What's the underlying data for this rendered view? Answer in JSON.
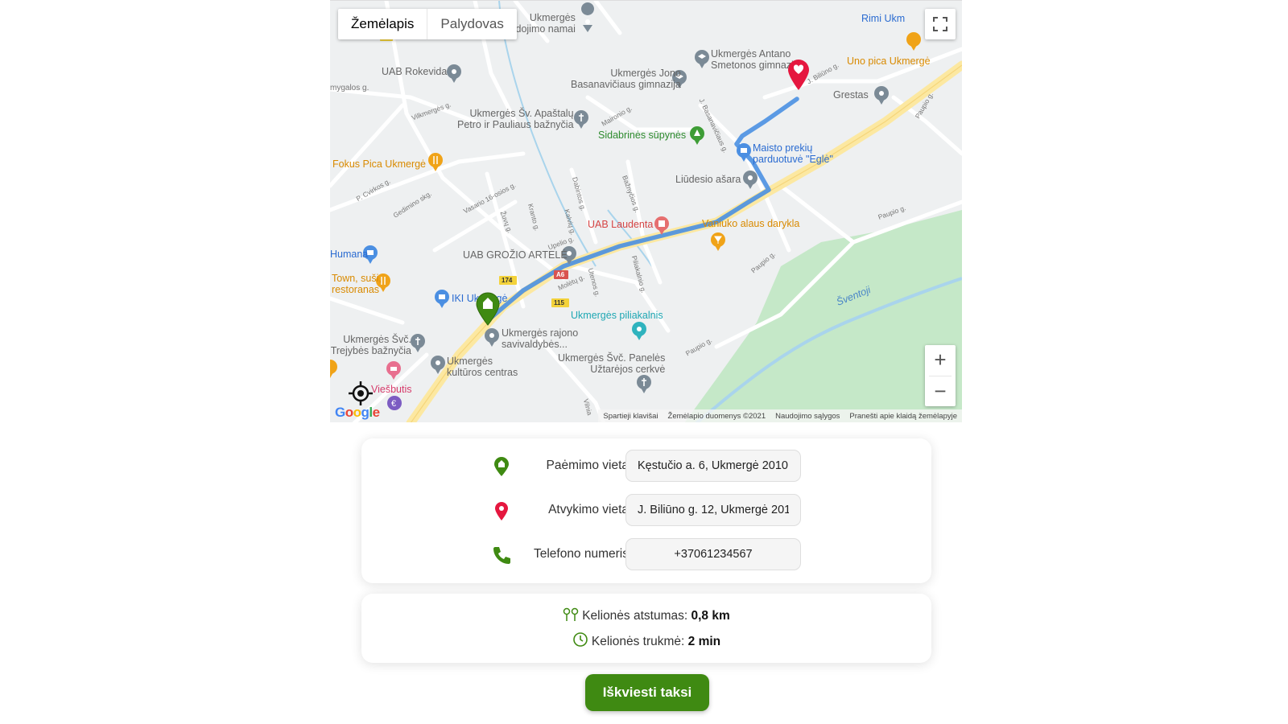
{
  "map": {
    "tabs": [
      {
        "label": "Žemėlapis",
        "active": true
      },
      {
        "label": "Palydovas",
        "active": false
      }
    ],
    "pois": {
      "laidojimo": "Ukmergės\nlaidojimo namai",
      "rimi": "Rimi Ukm",
      "smetonos": "Ukmergės Antano\nSmetonos gimnazija",
      "basanaviciaus": "Ukmergės Jono\nBasanavičiaus gimnazija",
      "unopica": "Uno pica Ukmergė",
      "rokevida": "UAB Rokevida",
      "baznycia": "Ukmergės Šv. Apaštalų\nPetro ir Pauliaus bažnyčia",
      "grestas": "Grestas",
      "supynes": "Sidabrinės sūpynės",
      "egle": "Maisto prekių\nparduotuvė \"Eglė\"",
      "fokus": "Fokus Pica Ukmergė",
      "liudesio": "Liūdesio ašara",
      "laudenta": "UAB Laudenta",
      "vaniuko": "Vaniuko alaus darykla",
      "humana": "Humana",
      "grozio": "UAB GROŽIO ARTELĖ",
      "town": "Town, suši,\nrestoranas",
      "iki": "IKI Ukmergė",
      "piliakalnis": "Ukmergės piliakalnis",
      "savivaldybe": "Ukmergės rajono\nsavivaldybės...",
      "trejybes": "Ukmergės Švč.\nTrejybės bažnyčia",
      "paneles": "Ukmergės Švč. Panelės\nUžtarėjos cerkvė",
      "kulturos": "Ukmergės\nkultūros centras",
      "viesbutis": "Viešbutis",
      "sventoji": "Šventoji"
    },
    "streets": {
      "mygalos": "mygalos g.",
      "vilkmerges": "Vilkmergės g.",
      "cvirkos": "P. Cvirkos g.",
      "gedimino": "Gedimino skg.",
      "vasario": "Vasario 16-osios g.",
      "zuvu": "Žuvų g.",
      "kranto": "Kranto g.",
      "dabintos": "Dabintos g.",
      "kalvių": "Kalvių g.",
      "baznycios": "Bažnyčios g.",
      "maironio": "Maironio g.",
      "jbasanaviciaus": "J. Basanavičiaus g.",
      "biliuno": "J. Biliūno g.",
      "paupio": "Paupio g.",
      "upelio": "Upelio g.",
      "moletu": "Molėtų g.",
      "utenos": "Utenos g.",
      "pilialkalnio": "Piliakalnio g.",
      "vilnius": "Vilnia"
    },
    "road_shields": [
      "A6",
      "174",
      "115"
    ],
    "controls": {
      "zoom_in": "+",
      "zoom_out": "−"
    },
    "google_logo": "Google",
    "attribution": [
      "Spartieji klavišai",
      "Žemėlapio duomenys ©2021",
      "Naudojimo sąlygos",
      "Pranešti apie klaidą žemėlapyje"
    ]
  },
  "form": {
    "pickup": {
      "label": "Paėmimo vieta",
      "value": "Kęstučio a. 6, Ukmergė 2010"
    },
    "dropoff": {
      "label": "Atvykimo vieta",
      "value": "J. Biliūno g. 12, Ukmergė 201"
    },
    "phone": {
      "label": "Telefono numeris",
      "value": "+37061234567"
    }
  },
  "trip": {
    "distance_label": "Kelionės atstumas:",
    "distance_value": "0,8 km",
    "duration_label": "Kelionės trukmė:",
    "duration_value": "2 min"
  },
  "call_button": "Iškviesti taksi",
  "colors": {
    "accent_green": "#3f8a12",
    "marker_red": "#e5173f",
    "route_blue": "#4a90e2",
    "park_green": "#c3e6c3"
  }
}
